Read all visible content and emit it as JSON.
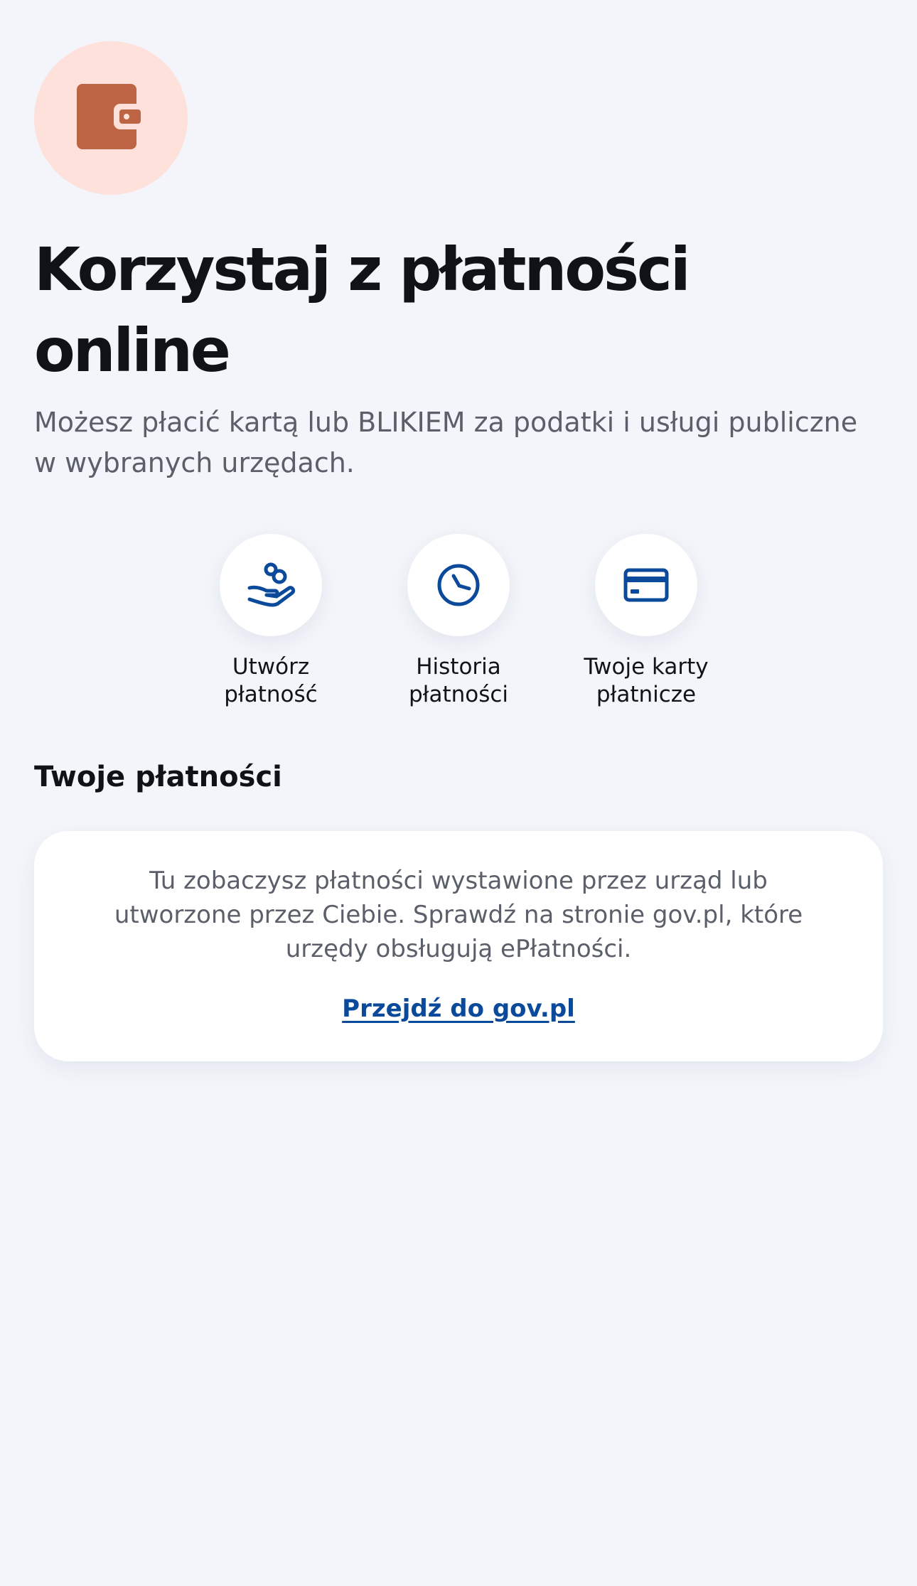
{
  "hero": {
    "icon": "wallet-icon",
    "icon_bg_color": "#fde1da",
    "icon_color": "#bd6444"
  },
  "header": {
    "title": "Korzystaj z płatności online",
    "subtitle": "Możesz płacić kartą lub BLIKIEM za podatki i usługi publiczne w wybranych urzędach."
  },
  "actions": [
    {
      "icon": "hand-coins-icon",
      "label": "Utwórz\npłatność"
    },
    {
      "icon": "clock-icon",
      "label": "Historia\npłatności"
    },
    {
      "icon": "credit-card-icon",
      "label": "Twoje karty\npłatnicze"
    }
  ],
  "payments": {
    "section_title": "Twoje płatności",
    "empty_text": "Tu zobaczysz płatności wystawione przez urząd lub utworzone przez Ciebie. Sprawdź na stronie gov.pl, które urzędy obsługują ePłatności.",
    "link_label": "Przejdź do gov.pl"
  },
  "colors": {
    "background": "#f3f5fa",
    "accent": "#0b4a9a",
    "title": "#101217",
    "muted_text": "#5a5f6a"
  }
}
